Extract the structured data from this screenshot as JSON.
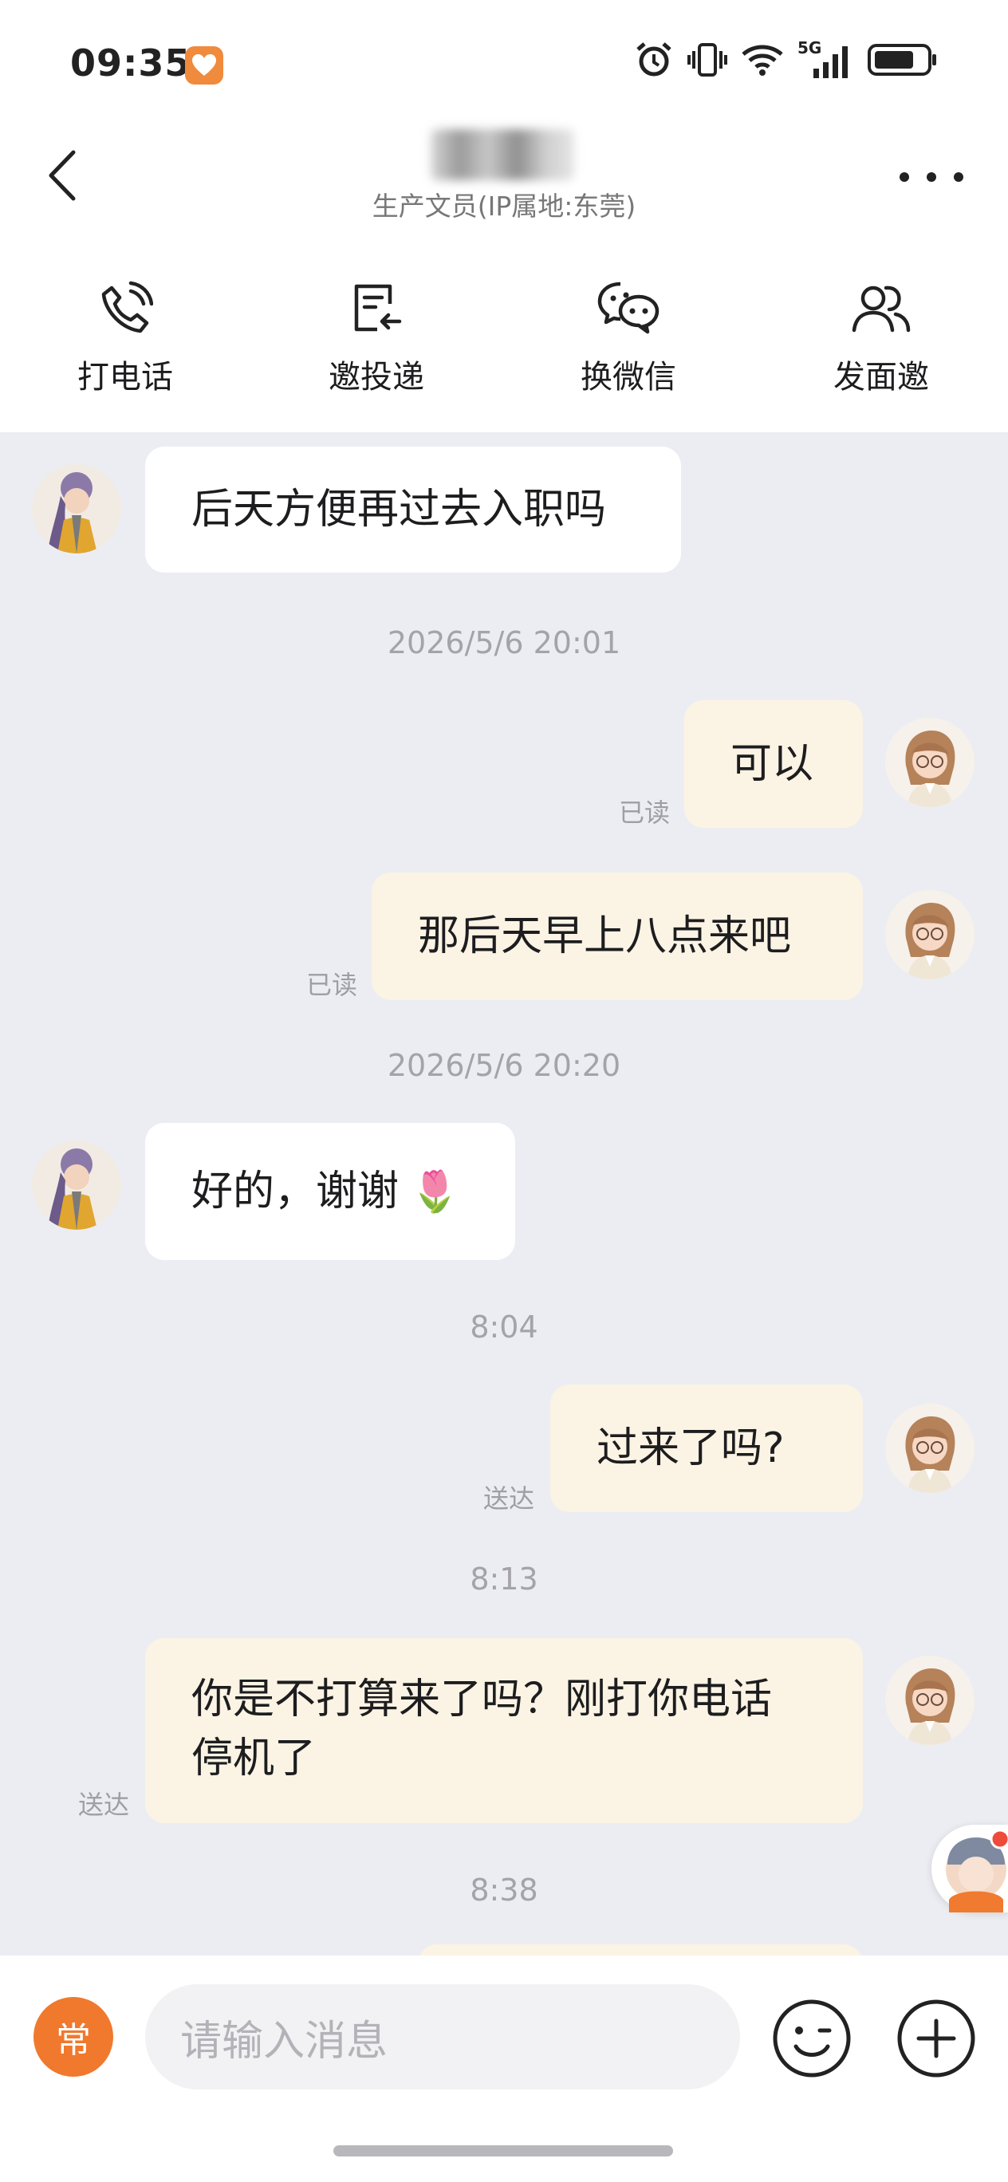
{
  "status_bar": {
    "time": "09:35",
    "network_label": "5G",
    "icons": [
      "heart-app-icon",
      "alarm-icon",
      "vibrate-icon",
      "wifi-icon",
      "signal-5g-icon",
      "battery-icon"
    ]
  },
  "header": {
    "subtitle": "生产文员(IP属地:东莞)",
    "icons": [
      "back-chevron-icon",
      "more-icon"
    ]
  },
  "actions": [
    {
      "label": "打电话",
      "icon": "phone-icon"
    },
    {
      "label": "邀投递",
      "icon": "invite-resume-icon"
    },
    {
      "label": "换微信",
      "icon": "wechat-icon"
    },
    {
      "label": "发面邀",
      "icon": "interview-icon"
    }
  ],
  "messages": {
    "m1": {
      "text": "后天方便再过去入职吗"
    },
    "t1": "2026/5/6 20:01",
    "m2": {
      "text": "可以",
      "status": "已读"
    },
    "m3": {
      "text": "那后天早上八点来吧",
      "status": "已读"
    },
    "t2": "2026/5/6 20:20",
    "m4": {
      "text": "好的，谢谢",
      "emoji": "🌷"
    },
    "t3": "8:04",
    "m5": {
      "text": "过来了吗?",
      "status": "送达"
    },
    "t4": "8:13",
    "m6": {
      "line1": "你是不打算来了吗？刚打你电话",
      "line2": "停机了",
      "status": "送达"
    },
    "t5": "8:38"
  },
  "input_bar": {
    "common_label": "常",
    "placeholder": "请输入消息",
    "icons": [
      "emoji-icon",
      "plus-icon"
    ]
  },
  "colors": {
    "accent": "#f0792d",
    "chat_background": "#ecedf2",
    "my_bubble": "#fbf3e4",
    "other_bubble": "#ffffff"
  }
}
